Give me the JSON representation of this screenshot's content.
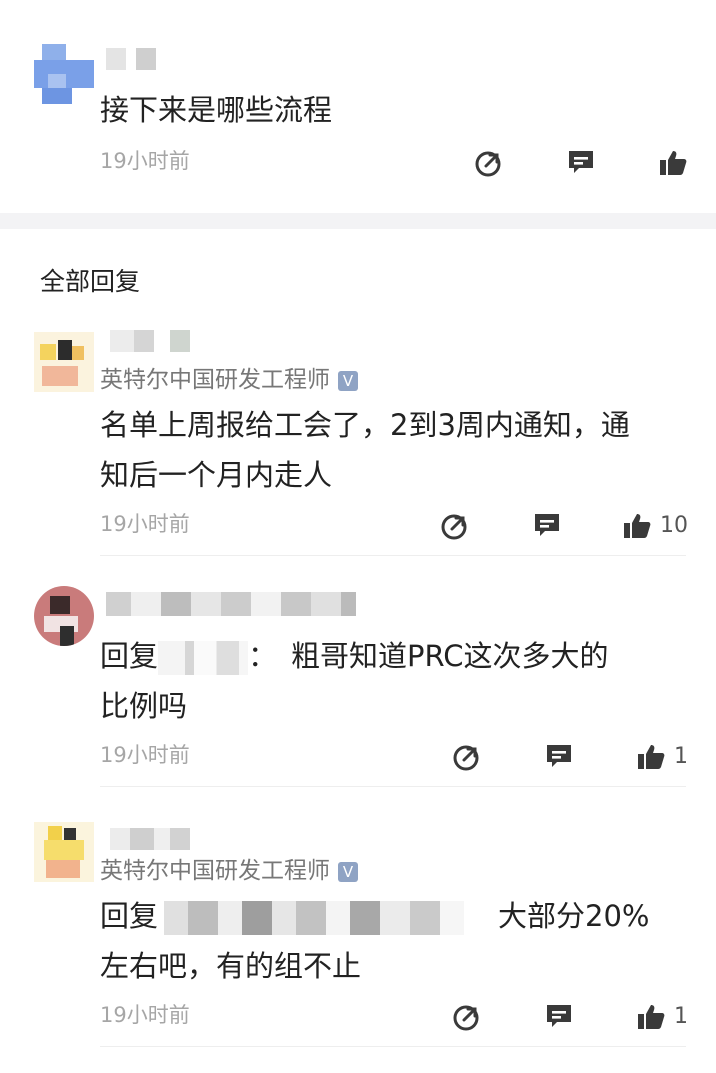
{
  "post": {
    "text": "接下来是哪些流程",
    "time": "19小时前"
  },
  "section_title": "全部回复",
  "replies": [
    {
      "user_title": "英特尔中国研发工程师",
      "badge": "V",
      "line1": "名单上周报给工会了，2到3周内通知，通",
      "line2": "知后一个月内走人",
      "time": "19小时前",
      "likes": "10"
    },
    {
      "reply_prefix": "回复",
      "reply_colon": "：",
      "line1_rest": "粗哥知道PRC这次多大的",
      "line2": "比例吗",
      "time": "19小时前",
      "likes": "1"
    },
    {
      "user_title": "英特尔中国研发工程师",
      "badge": "V",
      "reply_prefix": "回复",
      "line1_rest": "大部分20%",
      "line2": "左右吧，有的组不止",
      "time": "19小时前",
      "likes": "1"
    }
  ],
  "colors": {
    "icon": "#3a3a3a",
    "muted": "#a6a6a6",
    "badge": "#8fa3c4"
  },
  "icons": [
    "share-icon",
    "comment-icon",
    "thumbs-up-icon"
  ]
}
